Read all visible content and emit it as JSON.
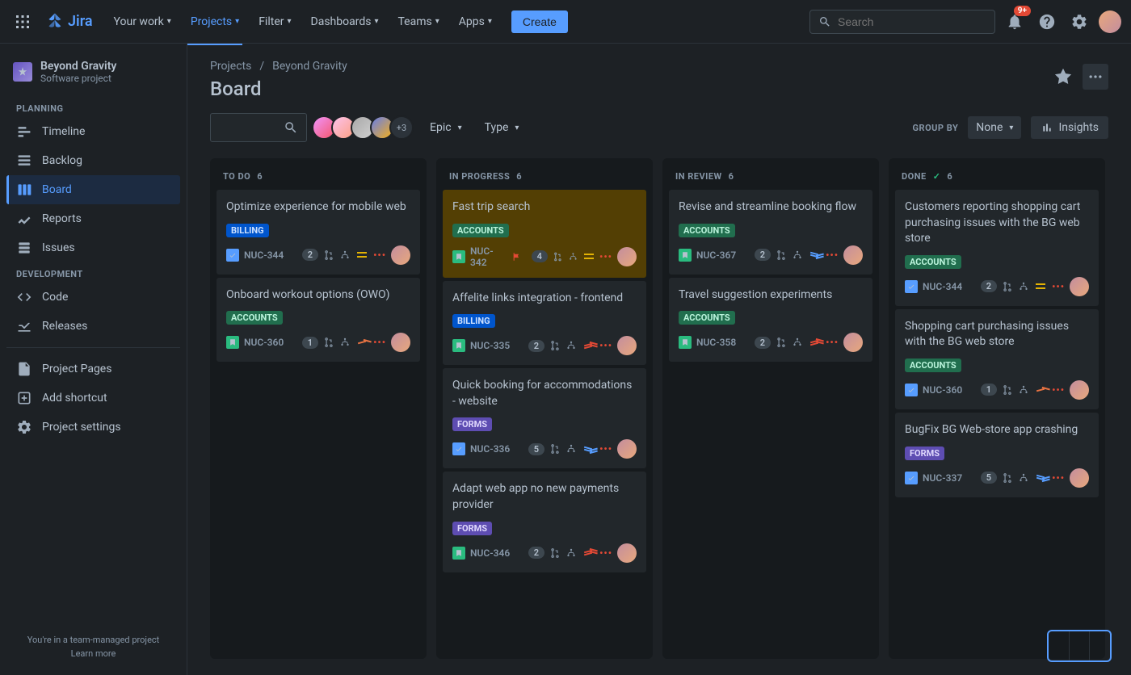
{
  "topbar": {
    "logo_text": "Jira",
    "nav": {
      "your_work": "Your work",
      "projects": "Projects",
      "filter": "Filter",
      "dashboards": "Dashboards",
      "teams": "Teams",
      "apps": "Apps"
    },
    "create_label": "Create",
    "search_placeholder": "Search",
    "notif_badge": "9+"
  },
  "sidebar": {
    "project_name": "Beyond Gravity",
    "project_type": "Software project",
    "sections": {
      "planning": "PLANNING",
      "development": "DEVELOPMENT"
    },
    "items": {
      "timeline": "Timeline",
      "backlog": "Backlog",
      "board": "Board",
      "reports": "Reports",
      "issues": "Issues",
      "code": "Code",
      "releases": "Releases",
      "project_pages": "Project Pages",
      "add_shortcut": "Add shortcut",
      "project_settings": "Project settings"
    },
    "footer": {
      "line1": "You're in a team-managed project",
      "learn_more": "Learn more"
    }
  },
  "main": {
    "breadcrumb": {
      "projects": "Projects",
      "project": "Beyond Gravity"
    },
    "title": "Board",
    "avatar_more": "+3",
    "epic_label": "Epic",
    "type_label": "Type",
    "groupby_label": "GROUP BY",
    "groupby_value": "None",
    "insights_label": "Insights"
  },
  "columns": [
    {
      "name": "TO DO",
      "count": "6",
      "cards": [
        {
          "title": "Optimize experience for mobile web",
          "tag": "BILLING",
          "tag_class": "billing",
          "type": "task",
          "key": "NUC-344",
          "badge": "2",
          "priority": "medium-lines"
        },
        {
          "title": "Onboard workout options (OWO)",
          "tag": "ACCOUNTS",
          "tag_class": "accounts",
          "type": "story",
          "key": "NUC-360",
          "badge": "1",
          "priority": "high"
        }
      ]
    },
    {
      "name": "IN PROGRESS",
      "count": "6",
      "cards": [
        {
          "title": "Fast trip search",
          "tag": "ACCOUNTS",
          "tag_class": "accounts",
          "type": "story",
          "key": "NUC-342",
          "badge": "4",
          "priority": "medium-lines",
          "highlight": true,
          "flag": true
        },
        {
          "title": "Affelite links integration - frontend",
          "tag": "BILLING",
          "tag_class": "billing",
          "type": "story",
          "key": "NUC-335",
          "badge": "2",
          "priority": "highest"
        },
        {
          "title": "Quick booking for accommodations - website",
          "tag": "FORMS",
          "tag_class": "forms",
          "type": "task",
          "key": "NUC-336",
          "badge": "5",
          "priority": "low"
        },
        {
          "title": "Adapt web app no new payments provider",
          "tag": "FORMS",
          "tag_class": "forms",
          "type": "story",
          "key": "NUC-346",
          "badge": "2",
          "priority": "highest"
        }
      ]
    },
    {
      "name": "IN REVIEW",
      "count": "6",
      "cards": [
        {
          "title": "Revise and streamline booking flow",
          "tag": "ACCOUNTS",
          "tag_class": "accounts",
          "type": "story",
          "key": "NUC-367",
          "badge": "2",
          "priority": "low"
        },
        {
          "title": "Travel suggestion experiments",
          "tag": "ACCOUNTS",
          "tag_class": "accounts",
          "type": "story",
          "key": "NUC-358",
          "badge": "2",
          "priority": "highest"
        }
      ]
    },
    {
      "name": "DONE",
      "count": "6",
      "done": true,
      "cards": [
        {
          "title": "Customers reporting shopping cart purchasing issues with the BG web store",
          "tag": "ACCOUNTS",
          "tag_class": "accounts",
          "type": "task",
          "key": "NUC-344",
          "badge": "2",
          "priority": "medium-lines"
        },
        {
          "title": "Shopping cart purchasing issues with the BG web store",
          "tag": "ACCOUNTS",
          "tag_class": "accounts",
          "type": "task",
          "key": "NUC-360",
          "badge": "1",
          "priority": "high"
        },
        {
          "title": "BugFix BG Web-store app crashing",
          "tag": "FORMS",
          "tag_class": "forms",
          "type": "task",
          "key": "NUC-337",
          "badge": "5",
          "priority": "low"
        }
      ]
    }
  ]
}
